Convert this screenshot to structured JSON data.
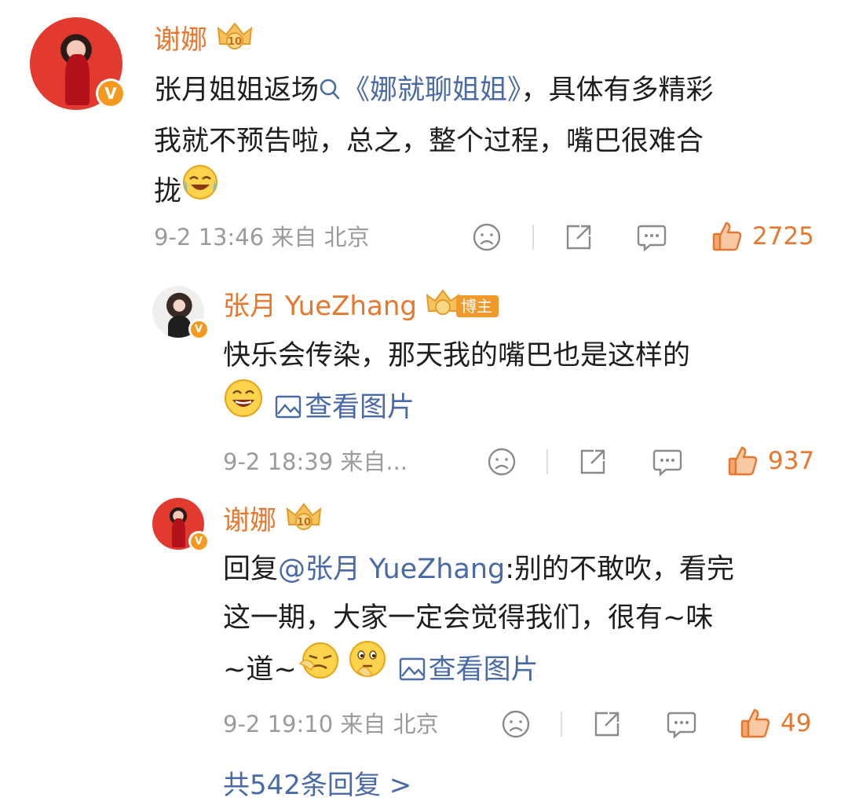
{
  "comments": [
    {
      "user": "谢娜",
      "text_prefix": "张月姐姐返场",
      "link": "《娜就聊姐姐》",
      "text_line1_suffix": "，具体有多精彩",
      "text_line2": "我就不预告啦，总之，整个过程，嘴巴很难合",
      "text_line3": "拢",
      "meta": "9-2 13:46  来自 北京",
      "likes": "2725",
      "verified_badge": "V",
      "level_badge": "10",
      "icons": [
        "search-icon",
        "laugh-cry-emoji",
        "frown-icon",
        "share-icon",
        "comment-icon",
        "thumb-up-icon"
      ]
    }
  ],
  "replies": [
    {
      "user": "张月 YueZhang",
      "role_badge": "博主",
      "text_line1": "快乐会传染，那天我的嘴巴也是这样的",
      "view_image": "查看图片",
      "meta": "9-2 18:39  来自...",
      "likes": "937",
      "verified_badge": "V"
    },
    {
      "user": "谢娜",
      "reply_prefix": "回复",
      "mention": "@张月 YueZhang",
      "text_line1_suffix": ":别的不敢吹，看完",
      "text_line2": "这一期，大家一定会觉得我们，很有~味",
      "text_line3": "~道~",
      "view_image": "查看图片",
      "meta": "9-2 19:10  来自 北京",
      "likes": "49",
      "verified_badge": "V",
      "level_badge": "10"
    }
  ],
  "more_replies": "共542条回复 >",
  "colors": {
    "username": "#e8772e",
    "link": "#4a6aa5",
    "meta": "#9b9b9b",
    "badge_orange": "#f59a1f"
  }
}
